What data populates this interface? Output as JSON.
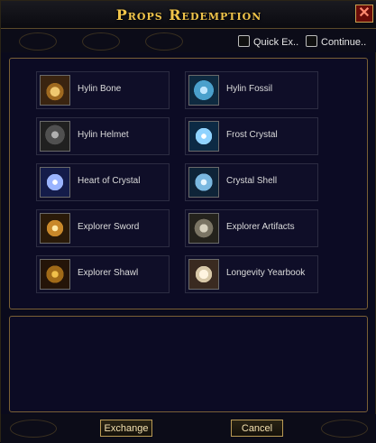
{
  "window": {
    "title": "Props Redemption"
  },
  "options": {
    "quick_label": "Quick Ex..",
    "continue_label": "Continue.."
  },
  "items": [
    {
      "name": "Hylin Bone",
      "icon": "bone-icon"
    },
    {
      "name": "Hylin Fossil",
      "icon": "fossil-icon"
    },
    {
      "name": "Hylin Helmet",
      "icon": "helmet-icon"
    },
    {
      "name": "Frost Crystal",
      "icon": "frost-crystal-icon"
    },
    {
      "name": "Heart of Crystal",
      "icon": "heart-crystal-icon"
    },
    {
      "name": "Crystal Shell",
      "icon": "crystal-shell-icon"
    },
    {
      "name": "Explorer Sword",
      "icon": "sword-icon"
    },
    {
      "name": "Explorer Artifacts",
      "icon": "artifacts-icon"
    },
    {
      "name": "Explorer Shawl",
      "icon": "shawl-icon"
    },
    {
      "name": "Longevity Yearbook",
      "icon": "yearbook-icon"
    }
  ],
  "buttons": {
    "exchange": "Exchange",
    "cancel": "Cancel"
  },
  "colors": {
    "title": "#f0c44a",
    "border": "#7a6036",
    "panel": "#0c0b24"
  }
}
